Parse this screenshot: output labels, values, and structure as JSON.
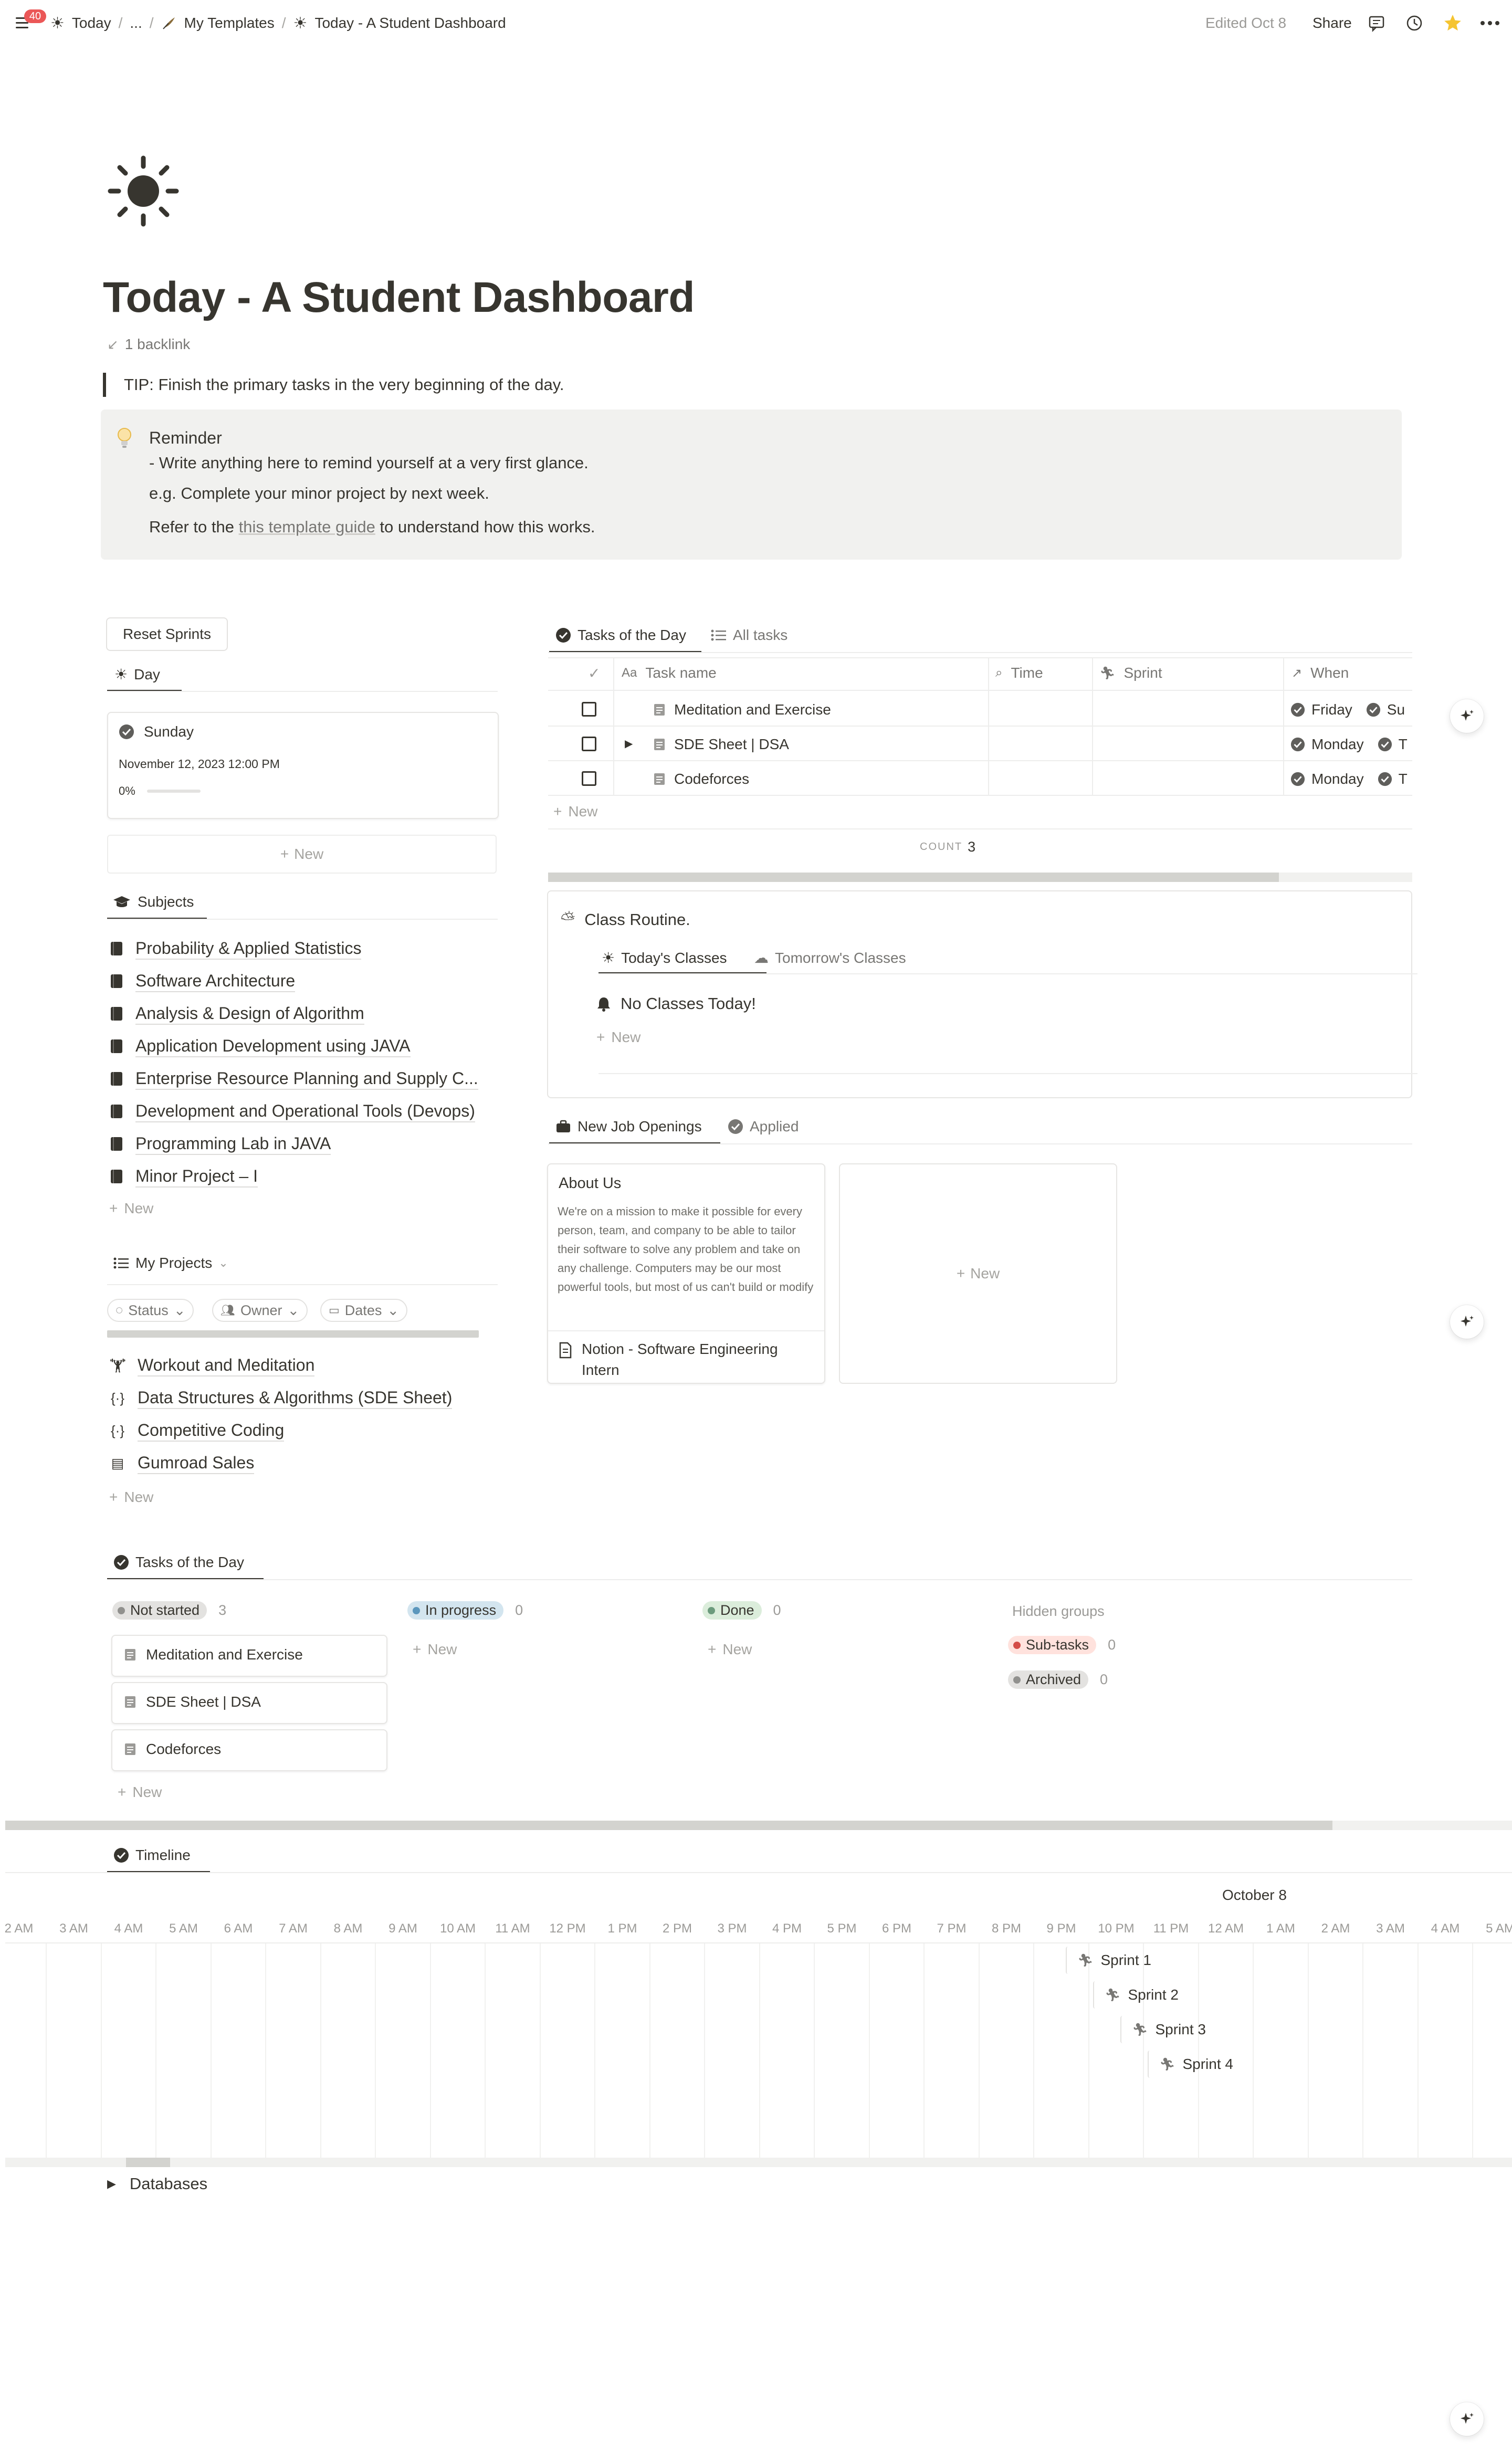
{
  "topbar": {
    "badge_count": "40",
    "breadcrumb_root": "Today",
    "breadcrumb_ellipsis": "...",
    "breadcrumb_parent": "My Templates",
    "breadcrumb_current": "Today - A Student Dashboard",
    "edited": "Edited Oct 8",
    "share": "Share"
  },
  "page": {
    "title": "Today - A Student Dashboard",
    "backlinks": "1 backlink",
    "tip": "TIP: Finish the primary tasks in the very beginning of the day."
  },
  "callout": {
    "heading": "Reminder",
    "line1": "- Write anything here to remind yourself at a very first glance.",
    "line2": "e.g. Complete your minor project by next week.",
    "line3_pre": "Refer to the ",
    "line3_link": "this template guide",
    "line3_post": " to understand how this works."
  },
  "sprints": {
    "reset_button": "Reset Sprints",
    "tab": "Day",
    "card_day": "Sunday",
    "card_date": "November 12, 2023 12:00 PM",
    "card_progress": "0%",
    "progress_value": 0,
    "new": "New"
  },
  "subjects": {
    "tab": "Subjects",
    "items": [
      "Probability & Applied Statistics",
      "Software Architecture",
      "Analysis & Design of Algorithm",
      "Application Development using JAVA",
      "Enterprise Resource Planning and Supply C...",
      "Development and Operational Tools (Devops)",
      "Programming Lab in JAVA",
      "Minor Project – I"
    ],
    "new": "New"
  },
  "projects": {
    "tab": "My Projects",
    "filters": [
      "Status",
      "Owner",
      "Dates"
    ],
    "items": [
      "Workout and Meditation",
      "Data Structures & Algorithms (SDE Sheet)",
      "Competitive Coding",
      "Gumroad Sales"
    ],
    "new": "New"
  },
  "tasks_table": {
    "tabs": [
      "Tasks of the Day",
      "All tasks"
    ],
    "columns": [
      "Task name",
      "Time",
      "Sprint",
      "When"
    ],
    "column_prefix": "Aa",
    "rows": [
      {
        "name": "Meditation and Exercise",
        "when": "Friday",
        "when2": "Su"
      },
      {
        "name": "SDE Sheet | DSA",
        "when": "Monday",
        "when2": "T"
      },
      {
        "name": "Codeforces",
        "when": "Monday",
        "when2": "T"
      }
    ],
    "new": "New",
    "count_label": "COUNT",
    "count_value": "3"
  },
  "class_routine": {
    "title": "Class Routine.",
    "tabs": [
      "Today's Classes",
      "Tomorrow's Classes"
    ],
    "item": "No Classes Today!",
    "new": "New"
  },
  "jobs": {
    "tabs": [
      "New Job Openings",
      "Applied"
    ],
    "card_heading": "About Us",
    "card_text": "We're on a mission to make it possible for every person, team, and company to be able to tailor their software to solve any problem and take on any challenge. Computers may be our most powerful tools, but most of us can't build or modify",
    "card_title": "Notion - Software Engineering Intern",
    "new": "New"
  },
  "board": {
    "tab": "Tasks of the Day",
    "groups": [
      {
        "name": "Not started",
        "count": "3",
        "color": "#91918e",
        "bg": "#e3e2e0"
      },
      {
        "name": "In progress",
        "count": "0",
        "color": "#5b97bd",
        "bg": "#d3e5ef"
      },
      {
        "name": "Done",
        "count": "0",
        "color": "#6c9b7d",
        "bg": "#dbeddb"
      }
    ],
    "cards": [
      "Meditation and Exercise",
      "SDE Sheet | DSA",
      "Codeforces"
    ],
    "new": "New",
    "hidden_label": "Hidden groups",
    "hidden": [
      {
        "name": "Sub-tasks",
        "count": "0",
        "color": "#d44c47",
        "bg": "#ffe2dd"
      },
      {
        "name": "Archived",
        "count": "0",
        "color": "#91918e",
        "bg": "#e3e2e0"
      }
    ]
  },
  "timeline": {
    "tab": "Timeline",
    "date_label": "October 8",
    "hours": [
      "2 AM",
      "3 AM",
      "4 AM",
      "5 AM",
      "6 AM",
      "7 AM",
      "8 AM",
      "9 AM",
      "10 AM",
      "11 AM",
      "12 PM",
      "1 PM",
      "2 PM",
      "3 PM",
      "4 PM",
      "5 PM",
      "6 PM",
      "7 PM",
      "8 PM",
      "9 PM",
      "10 PM",
      "11 PM",
      "12 AM",
      "1 AM",
      "2 AM",
      "3 AM",
      "4 AM",
      "5 AM"
    ],
    "sprints": [
      "Sprint 1",
      "Sprint 2",
      "Sprint 3",
      "Sprint 4"
    ]
  },
  "databases": {
    "label": "Databases"
  },
  "colors": {
    "text": "#37352f",
    "muted": "#787774",
    "border": "#ededec",
    "callout_bg": "#f1f1ef",
    "star": "#f5c431",
    "badge": "#eb5757"
  },
  "icons": [
    "menu-icon",
    "sun-icon",
    "quill-icon",
    "comment-icon",
    "clock-icon",
    "star-icon",
    "more-icon",
    "bulb-icon",
    "check-circle-icon",
    "book-icon",
    "list-icon",
    "bell-icon",
    "briefcase-icon",
    "runner-icon",
    "page-icon",
    "sparkle-icon"
  ]
}
